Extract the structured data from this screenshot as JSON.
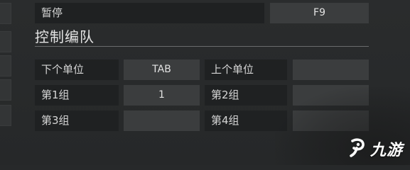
{
  "pause_row": {
    "label": "暂停",
    "key": "F9"
  },
  "section": {
    "title": "控制编队"
  },
  "bindings": {
    "next_unit": {
      "label": "下个单位",
      "key": "TAB"
    },
    "prev_unit": {
      "label": "上个单位",
      "key": ""
    },
    "group1": {
      "label": "第1组",
      "key": "1"
    },
    "group2": {
      "label": "第2组",
      "key": ""
    },
    "group3": {
      "label": "第3组",
      "key": ""
    },
    "group4": {
      "label": "第4组",
      "key": ""
    }
  },
  "watermark": {
    "brand": "九游",
    "icon": "jiuyou-logo-icon"
  }
}
